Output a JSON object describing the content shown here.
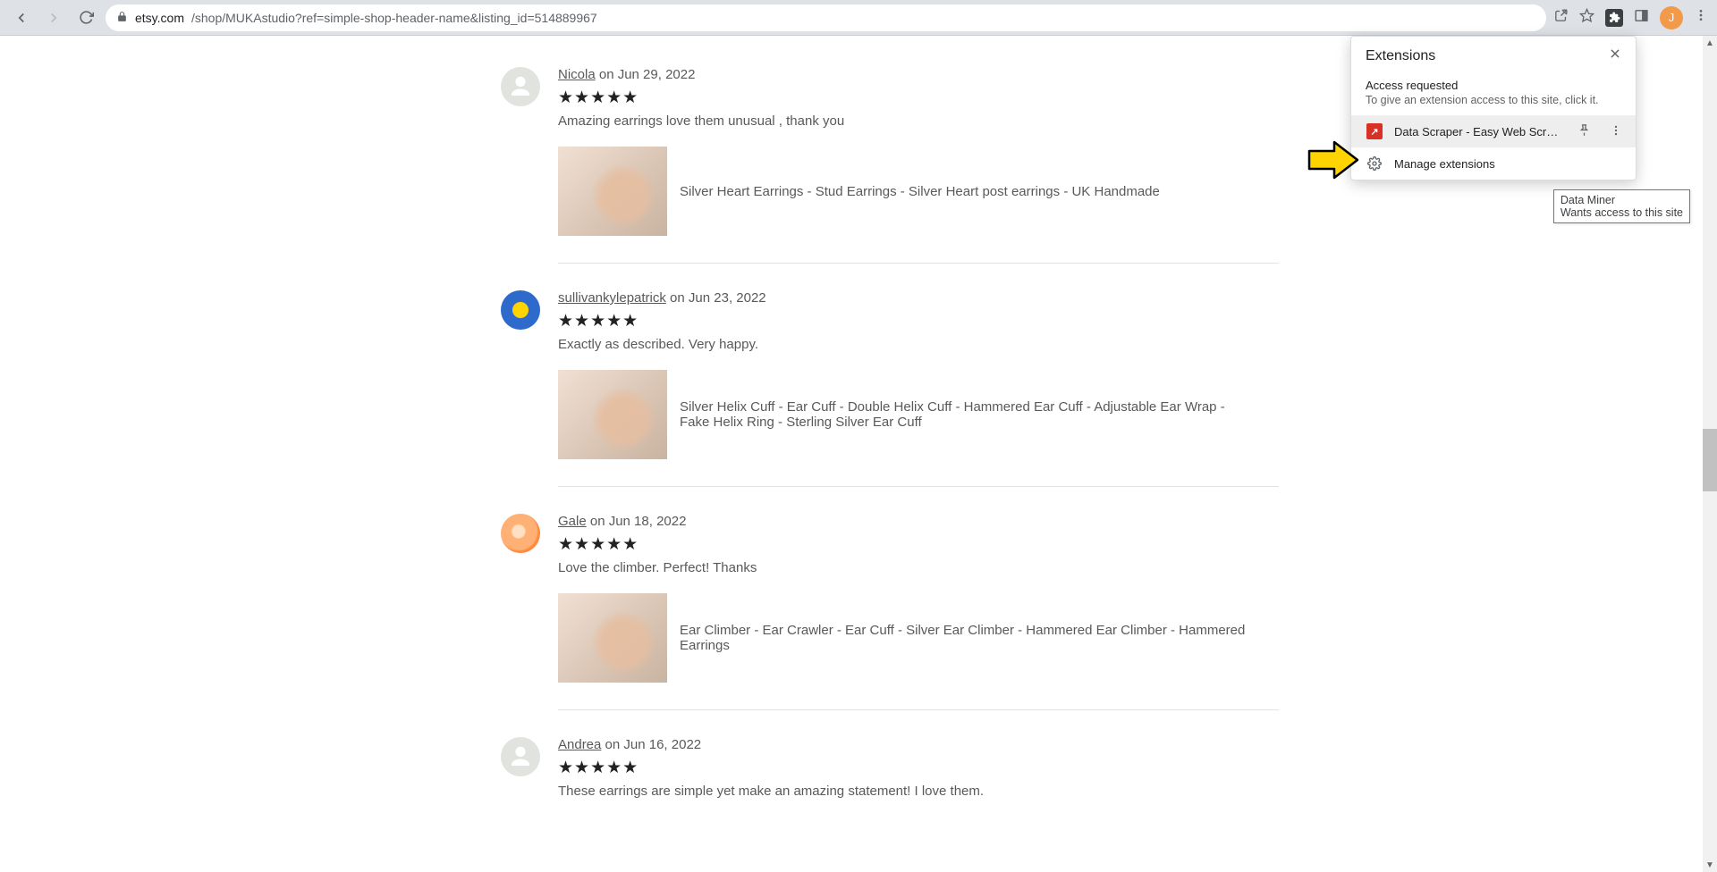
{
  "browser": {
    "url_host": "etsy.com",
    "url_path": "/shop/MUKAstudio?ref=simple-shop-header-name&listing_id=514889967",
    "profile_letter": "J"
  },
  "extensions_popup": {
    "title": "Extensions",
    "section_title": "Access requested",
    "section_sub": "To give an extension access to this site, click it.",
    "item_name": "Data Scraper - Easy Web Scrapi...",
    "manage": "Manage extensions"
  },
  "tooltip": {
    "line1": "Data Miner",
    "line2": "Wants access to this site"
  },
  "reviews": [
    {
      "user": "Nicola",
      "date": "Jun 29, 2022",
      "text": "Amazing earrings love them unusual , thank you",
      "product": "Silver Heart Earrings - Stud Earrings - Silver Heart post earrings - UK Handmade",
      "avatar": "person"
    },
    {
      "user": "sullivankylepatrick",
      "date": "Jun 23, 2022",
      "text": "Exactly as described. Very happy.",
      "product": "Silver Helix Cuff - Ear Cuff - Double Helix Cuff - Hammered Ear Cuff - Adjustable Ear Wrap - Fake Helix Ring - Sterling Silver Ear Cuff",
      "avatar": "sunflower"
    },
    {
      "user": "Gale",
      "date": "Jun 18, 2022",
      "text": "Love the climber. Perfect! Thanks",
      "product": "Ear Climber - Ear Crawler - Ear Cuff - Silver Ear Climber - Hammered Ear Climber - Hammered Earrings",
      "avatar": "rose"
    },
    {
      "user": "Andrea",
      "date": "Jun 16, 2022",
      "text": "These earrings are simple yet make an amazing statement! I love them.",
      "product": "",
      "avatar": "person"
    }
  ]
}
